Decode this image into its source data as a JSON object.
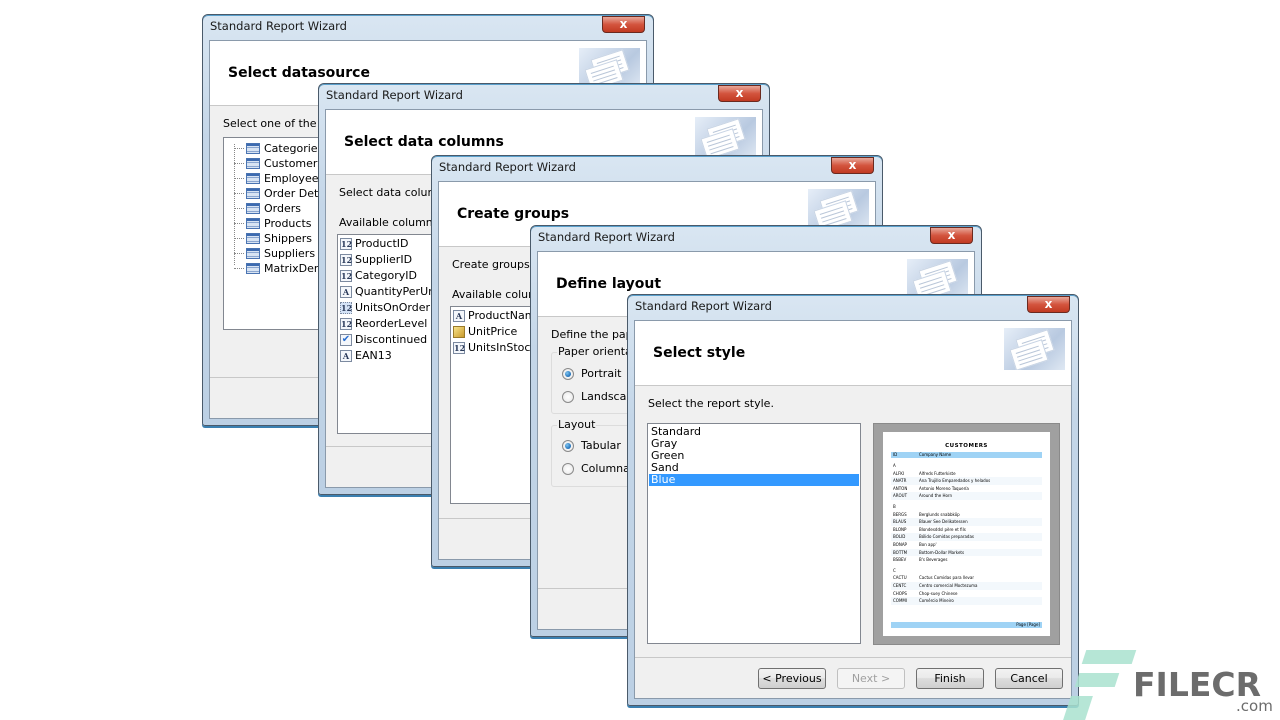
{
  "window_title": "Standard Report Wizard",
  "close_glyph": "x",
  "dialogs": [
    {
      "step_title": "Select datasource",
      "description": "Select one of the available data sources",
      "tree_items": [
        "Categories",
        "Customers",
        "Employees",
        "Order Details",
        "Orders",
        "Products",
        "Shippers",
        "Suppliers",
        "MatrixDemo"
      ]
    },
    {
      "step_title": "Select data columns",
      "description": "Select data columns",
      "available_label": "Available columns:",
      "columns": [
        {
          "name": "ProductID",
          "type_icon": "numeric-icon",
          "glyph": "12"
        },
        {
          "name": "SupplierID",
          "type_icon": "numeric-icon",
          "glyph": "12"
        },
        {
          "name": "CategoryID",
          "type_icon": "numeric-icon",
          "glyph": "12"
        },
        {
          "name": "QuantityPerUnit",
          "type_icon": "text-icon",
          "glyph": "A"
        },
        {
          "name": "UnitsOnOrder",
          "type_icon": "numeric-icon",
          "glyph": "12"
        },
        {
          "name": "ReorderLevel",
          "type_icon": "numeric-icon",
          "glyph": "12"
        },
        {
          "name": "Discontinued",
          "type_icon": "boolean-icon",
          "glyph": "✔"
        },
        {
          "name": "EAN13",
          "type_icon": "text-icon",
          "glyph": "A"
        }
      ]
    },
    {
      "step_title": "Create groups",
      "description": "Create groups (optional)",
      "available_label": "Available columns:",
      "columns": [
        {
          "name": "ProductName",
          "type_icon": "text-icon",
          "glyph": "A"
        },
        {
          "name": "UnitPrice",
          "type_icon": "currency-icon",
          "glyph": ""
        },
        {
          "name": "UnitsInStock",
          "type_icon": "numeric-icon",
          "glyph": "12"
        }
      ]
    },
    {
      "step_title": "Define layout",
      "description": "Define the paper orientation and layout",
      "orientation_label": "Paper orientation",
      "orientation_options": [
        "Portrait",
        "Landscape"
      ],
      "orientation_selected": "Portrait",
      "layout_label": "Layout",
      "layout_options": [
        "Tabular",
        "Columnar"
      ],
      "layout_selected": "Tabular"
    },
    {
      "step_title": "Select style",
      "description": "Select the report style.",
      "styles": [
        "Standard",
        "Gray",
        "Green",
        "Sand",
        "Blue"
      ],
      "selected_style": "Blue",
      "preview": {
        "title": "CUSTOMERS",
        "header": [
          "ID",
          "Company Name"
        ],
        "groups": [
          {
            "letter": "A",
            "rows": [
              [
                "ALFKI",
                "Alfreds Futterkiste"
              ],
              [
                "ANATR",
                "Ana Trujillo Emparedados y helados"
              ],
              [
                "ANTON",
                "Antonio Moreno Taquería"
              ],
              [
                "AROUT",
                "Around the Horn"
              ]
            ]
          },
          {
            "letter": "B",
            "rows": [
              [
                "BERGS",
                "Berglunds snabbköp"
              ],
              [
                "BLAUS",
                "Blauer See Delikatessen"
              ],
              [
                "BLONP",
                "Blondesddsl père et fils"
              ],
              [
                "BOLID",
                "Bólido Comidas preparadas"
              ],
              [
                "BONAP",
                "Bon app'"
              ],
              [
                "BOTTM",
                "Bottom-Dollar Markets"
              ],
              [
                "BSBEV",
                "B's Beverages"
              ]
            ]
          },
          {
            "letter": "C",
            "rows": [
              [
                "CACTU",
                "Cactus Comidas para llevar"
              ],
              [
                "CENTC",
                "Centro comercial Moctezuma"
              ],
              [
                "CHOPS",
                "Chop-suey Chinese"
              ],
              [
                "COMMI",
                "Comércio Mineiro"
              ]
            ]
          }
        ],
        "footer": "Page [Page]"
      },
      "buttons": {
        "previous": "< Previous",
        "next": "Next >",
        "finish": "Finish",
        "cancel": "Cancel"
      },
      "next_enabled": false
    }
  ],
  "watermark": {
    "brand": "FILECR",
    "suffix": ".com",
    "accent": "#a9e2cf",
    "text_color": "#6c6c6c"
  },
  "colors": {
    "selection": "#3399ff",
    "preview_band": "#9fd3f5",
    "close_button": "#d3543e"
  }
}
